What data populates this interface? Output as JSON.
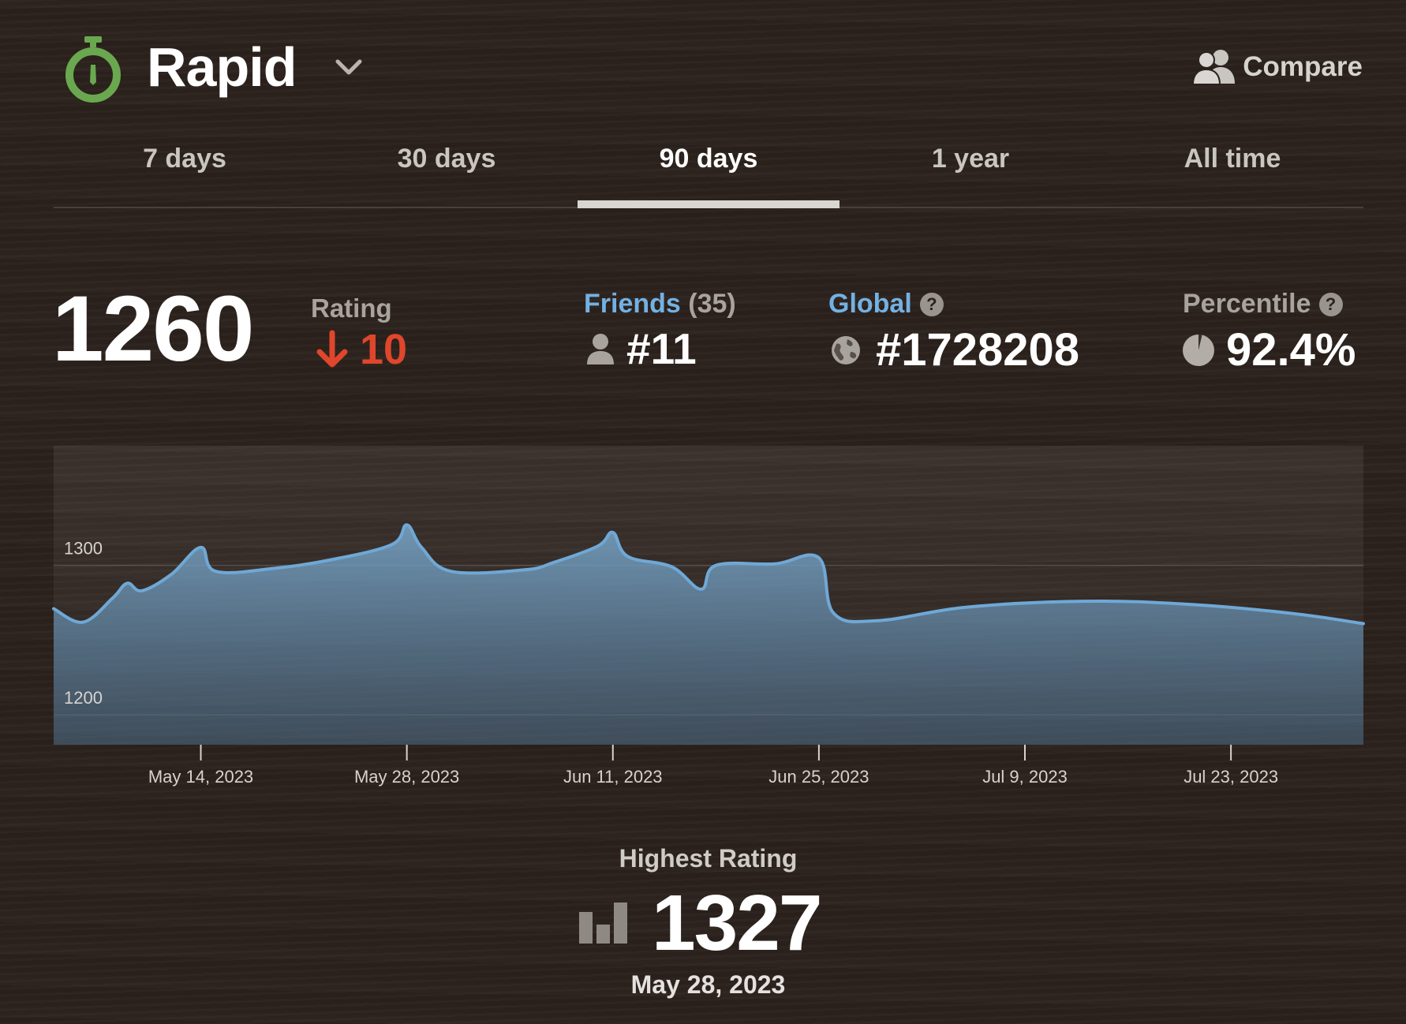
{
  "header": {
    "title": "Rapid",
    "compare_label": "Compare"
  },
  "tabs": [
    {
      "label": "7 days",
      "active": false
    },
    {
      "label": "30 days",
      "active": false
    },
    {
      "label": "90 days",
      "active": true
    },
    {
      "label": "1 year",
      "active": false
    },
    {
      "label": "All time",
      "active": false
    }
  ],
  "stats": {
    "rating": "1260",
    "rating_label": "Rating",
    "rating_change": "10",
    "friends_label": "Friends",
    "friends_count": "(35)",
    "friends_rank": "#11",
    "global_label": "Global",
    "global_rank": "#1728208",
    "percentile_label": "Percentile",
    "percentile_value": "92.4%",
    "help_symbol": "?"
  },
  "colors": {
    "accent_blue": "#73b1e3",
    "down_red": "#e0462c",
    "icon_green": "#6aa84f",
    "line": "#6fa8d6"
  },
  "chart_data": {
    "type": "area",
    "ylabel_ticks": [
      1200,
      1300
    ],
    "ylim": [
      1180,
      1380
    ],
    "xlim": [
      "2023-05-04",
      "2023-08-01"
    ],
    "x_tick_labels": [
      "May 14, 2023",
      "May 28, 2023",
      "Jun 11, 2023",
      "Jun 25, 2023",
      "Jul 9, 2023",
      "Jul 23, 2023"
    ],
    "x_tick_dates": [
      "2023-05-14",
      "2023-05-28",
      "2023-06-11",
      "2023-06-25",
      "2023-07-09",
      "2023-07-23"
    ],
    "grid": "horizontal",
    "series": [
      {
        "points": [
          [
            "2023-05-04",
            1271
          ],
          [
            "2023-05-06",
            1262
          ],
          [
            "2023-05-08",
            1278
          ],
          [
            "2023-05-09",
            1288
          ],
          [
            "2023-05-10",
            1283
          ],
          [
            "2023-05-12",
            1294
          ],
          [
            "2023-05-14",
            1312
          ],
          [
            "2023-05-15",
            1296
          ],
          [
            "2023-05-19",
            1298
          ],
          [
            "2023-05-23",
            1304
          ],
          [
            "2023-05-27",
            1314
          ],
          [
            "2023-05-28",
            1327
          ],
          [
            "2023-05-29",
            1312
          ],
          [
            "2023-05-31",
            1296
          ],
          [
            "2023-06-05",
            1297
          ],
          [
            "2023-06-07",
            1302
          ],
          [
            "2023-06-10",
            1313
          ],
          [
            "2023-06-11",
            1322
          ],
          [
            "2023-06-12",
            1306
          ],
          [
            "2023-06-15",
            1299
          ],
          [
            "2023-06-17",
            1284
          ],
          [
            "2023-06-18",
            1300
          ],
          [
            "2023-06-22",
            1301
          ],
          [
            "2023-06-25",
            1305
          ],
          [
            "2023-06-26",
            1268
          ],
          [
            "2023-06-29",
            1263
          ],
          [
            "2023-07-05",
            1272
          ],
          [
            "2023-07-13",
            1276
          ],
          [
            "2023-07-20",
            1274
          ],
          [
            "2023-07-27",
            1268
          ],
          [
            "2023-08-01",
            1261
          ]
        ]
      }
    ]
  },
  "highest": {
    "label": "Highest Rating",
    "value": "1327",
    "date": "May 28, 2023"
  }
}
